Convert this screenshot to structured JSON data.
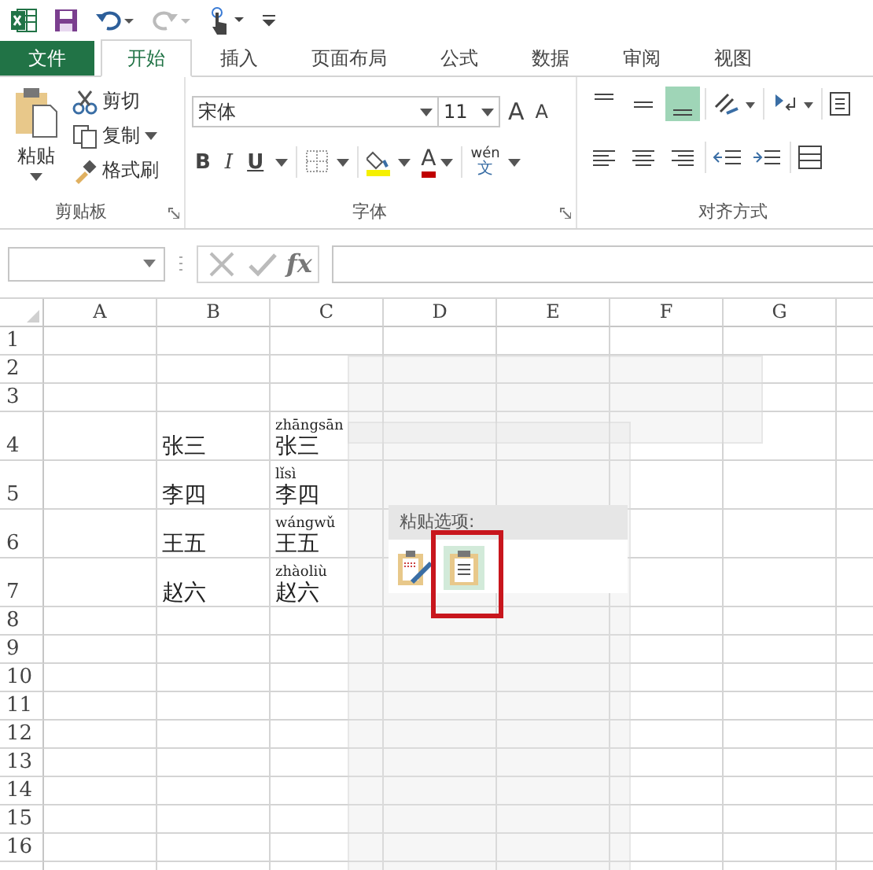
{
  "tabs": [
    {
      "label": "文件",
      "kind": "file",
      "selected": false
    },
    {
      "label": "开始",
      "kind": "tab",
      "selected": true
    },
    {
      "label": "插入",
      "kind": "tab",
      "selected": false
    },
    {
      "label": "页面布局",
      "kind": "tab",
      "selected": false
    },
    {
      "label": "公式",
      "kind": "tab",
      "selected": false
    },
    {
      "label": "数据",
      "kind": "tab",
      "selected": false
    },
    {
      "label": "审阅",
      "kind": "tab",
      "selected": false
    },
    {
      "label": "视图",
      "kind": "tab",
      "selected": false
    }
  ],
  "clipboard": {
    "paste": "粘贴",
    "cut": "剪切",
    "copy": "复制",
    "format_painter": "格式刷",
    "label": "剪贴板"
  },
  "font": {
    "name": "宋体",
    "size": "11",
    "grow": "A",
    "shrink": "A",
    "bold": "B",
    "italic": "I",
    "underline": "U",
    "color_letter": "A",
    "phonetic_top": "wén",
    "phonetic_bottom": "文",
    "label": "字体"
  },
  "alignment": {
    "label": "对齐方式"
  },
  "formula_bar": {
    "fx": "fx"
  },
  "columns": [
    "A",
    "B",
    "C",
    "D",
    "E",
    "F",
    "G"
  ],
  "rows": [
    {
      "header": "1"
    },
    {
      "header": "2"
    },
    {
      "header": "3"
    },
    {
      "header": "4",
      "b": "张三",
      "pinyin": "zhāngsān",
      "c": "张三"
    },
    {
      "header": "5",
      "b": "李四",
      "pinyin": "lǐsì",
      "c": "李四"
    },
    {
      "header": "6",
      "b": "王五",
      "pinyin": "wángwǔ",
      "c": "王五"
    },
    {
      "header": "7",
      "b": "赵六",
      "pinyin": "zhàoliù",
      "c": "赵六"
    },
    {
      "header": "8"
    },
    {
      "header": "9"
    },
    {
      "header": "10"
    },
    {
      "header": "11"
    },
    {
      "header": "12"
    },
    {
      "header": "13"
    },
    {
      "header": "14"
    },
    {
      "header": "15"
    },
    {
      "header": "16"
    }
  ],
  "paste_options": {
    "title": "粘贴选项:"
  }
}
